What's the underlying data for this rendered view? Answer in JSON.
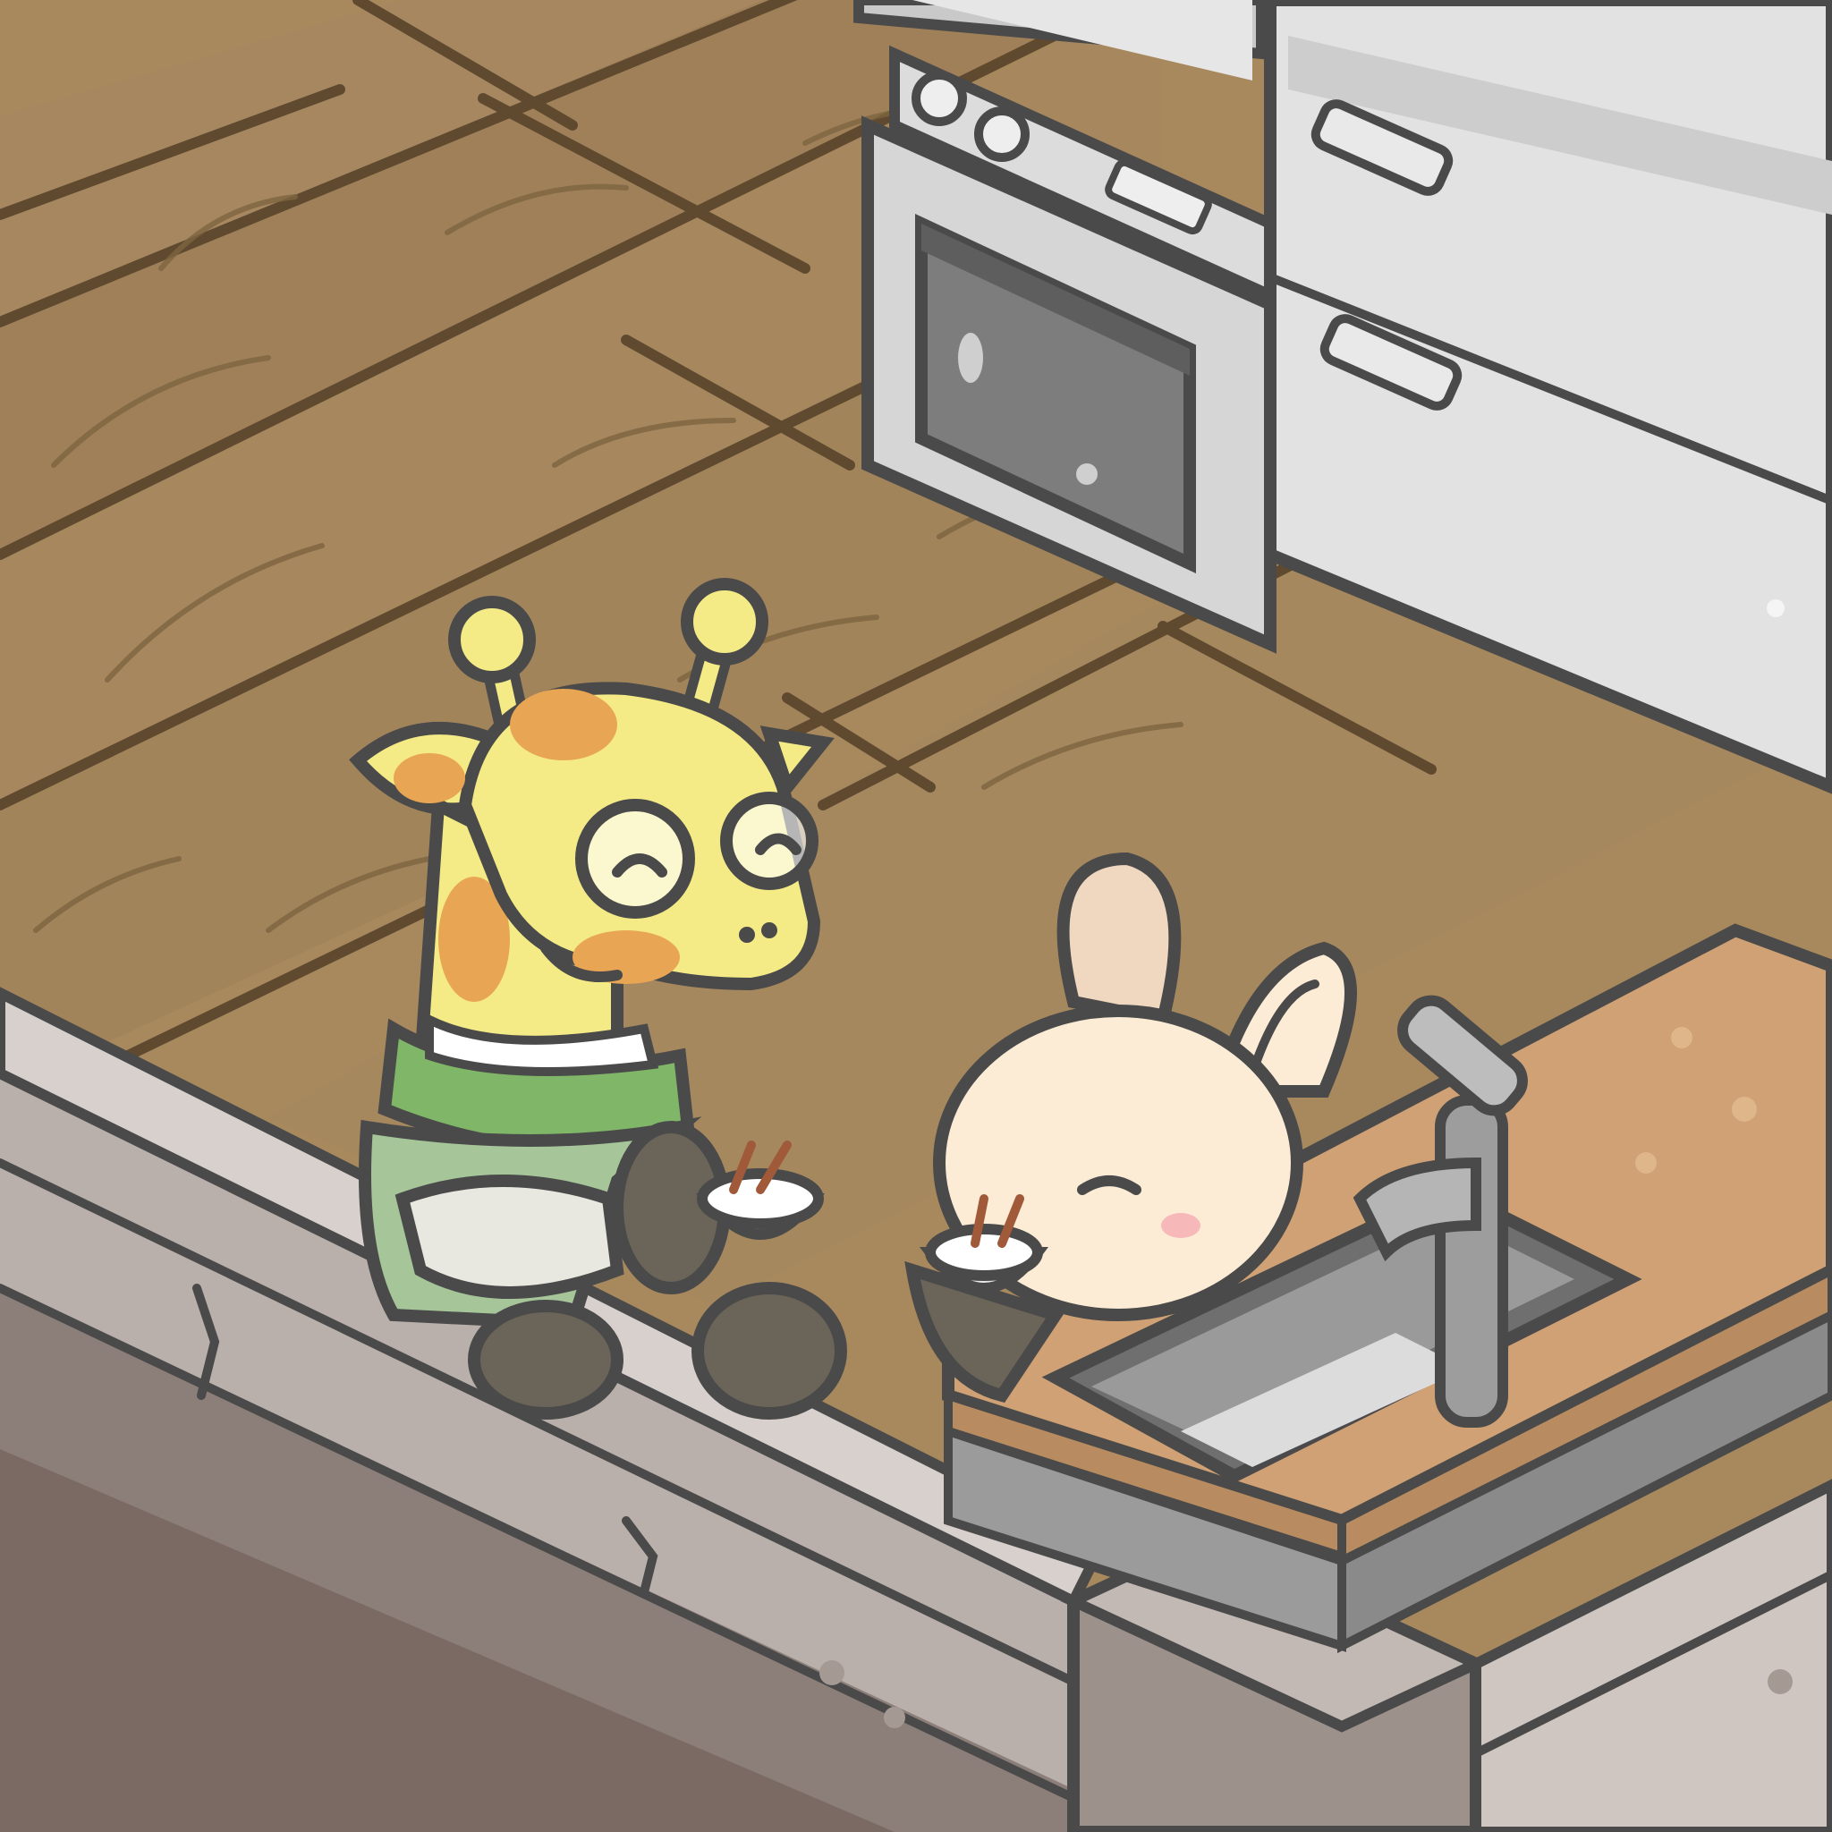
{
  "scene": {
    "description_free": true,
    "characters": [
      {
        "id": "giraffe",
        "icon": "giraffe-character",
        "holding": "rice-bowl"
      },
      {
        "id": "bunny",
        "icon": "bunny-character",
        "holding": "rice-bowl"
      }
    ],
    "props": [
      "oven-range",
      "refrigerator",
      "kitchen-counter",
      "sink",
      "faucet",
      "wooden-floor",
      "wall-ledge"
    ]
  },
  "colors": {
    "floor_plank": "#a8895e",
    "floor_plank_dark": "#8e7149",
    "floor_line": "#5f4a30",
    "outline": "#4a4a4a",
    "oven_body": "#d6d6d6",
    "oven_window": "#7d7d7d",
    "fridge": "#e2e2e2",
    "ledge_top": "#d8d0cc",
    "ledge_front": "#b9afab",
    "ledge_dark": "#8c7e78",
    "counter_top": "#cfa174",
    "counter_edge": "#b88c60",
    "sink": "#8f8f8f",
    "giraffe_yellow": "#f4ea86",
    "giraffe_spot": "#e8a654",
    "giraffe_scarf": "#7fb668",
    "giraffe_apron": "#e9e8e0",
    "bunny_fur": "#fcecd6",
    "bunny_ear_inner": "#f0d7bf",
    "bunny_blush": "#f6b8b8"
  }
}
